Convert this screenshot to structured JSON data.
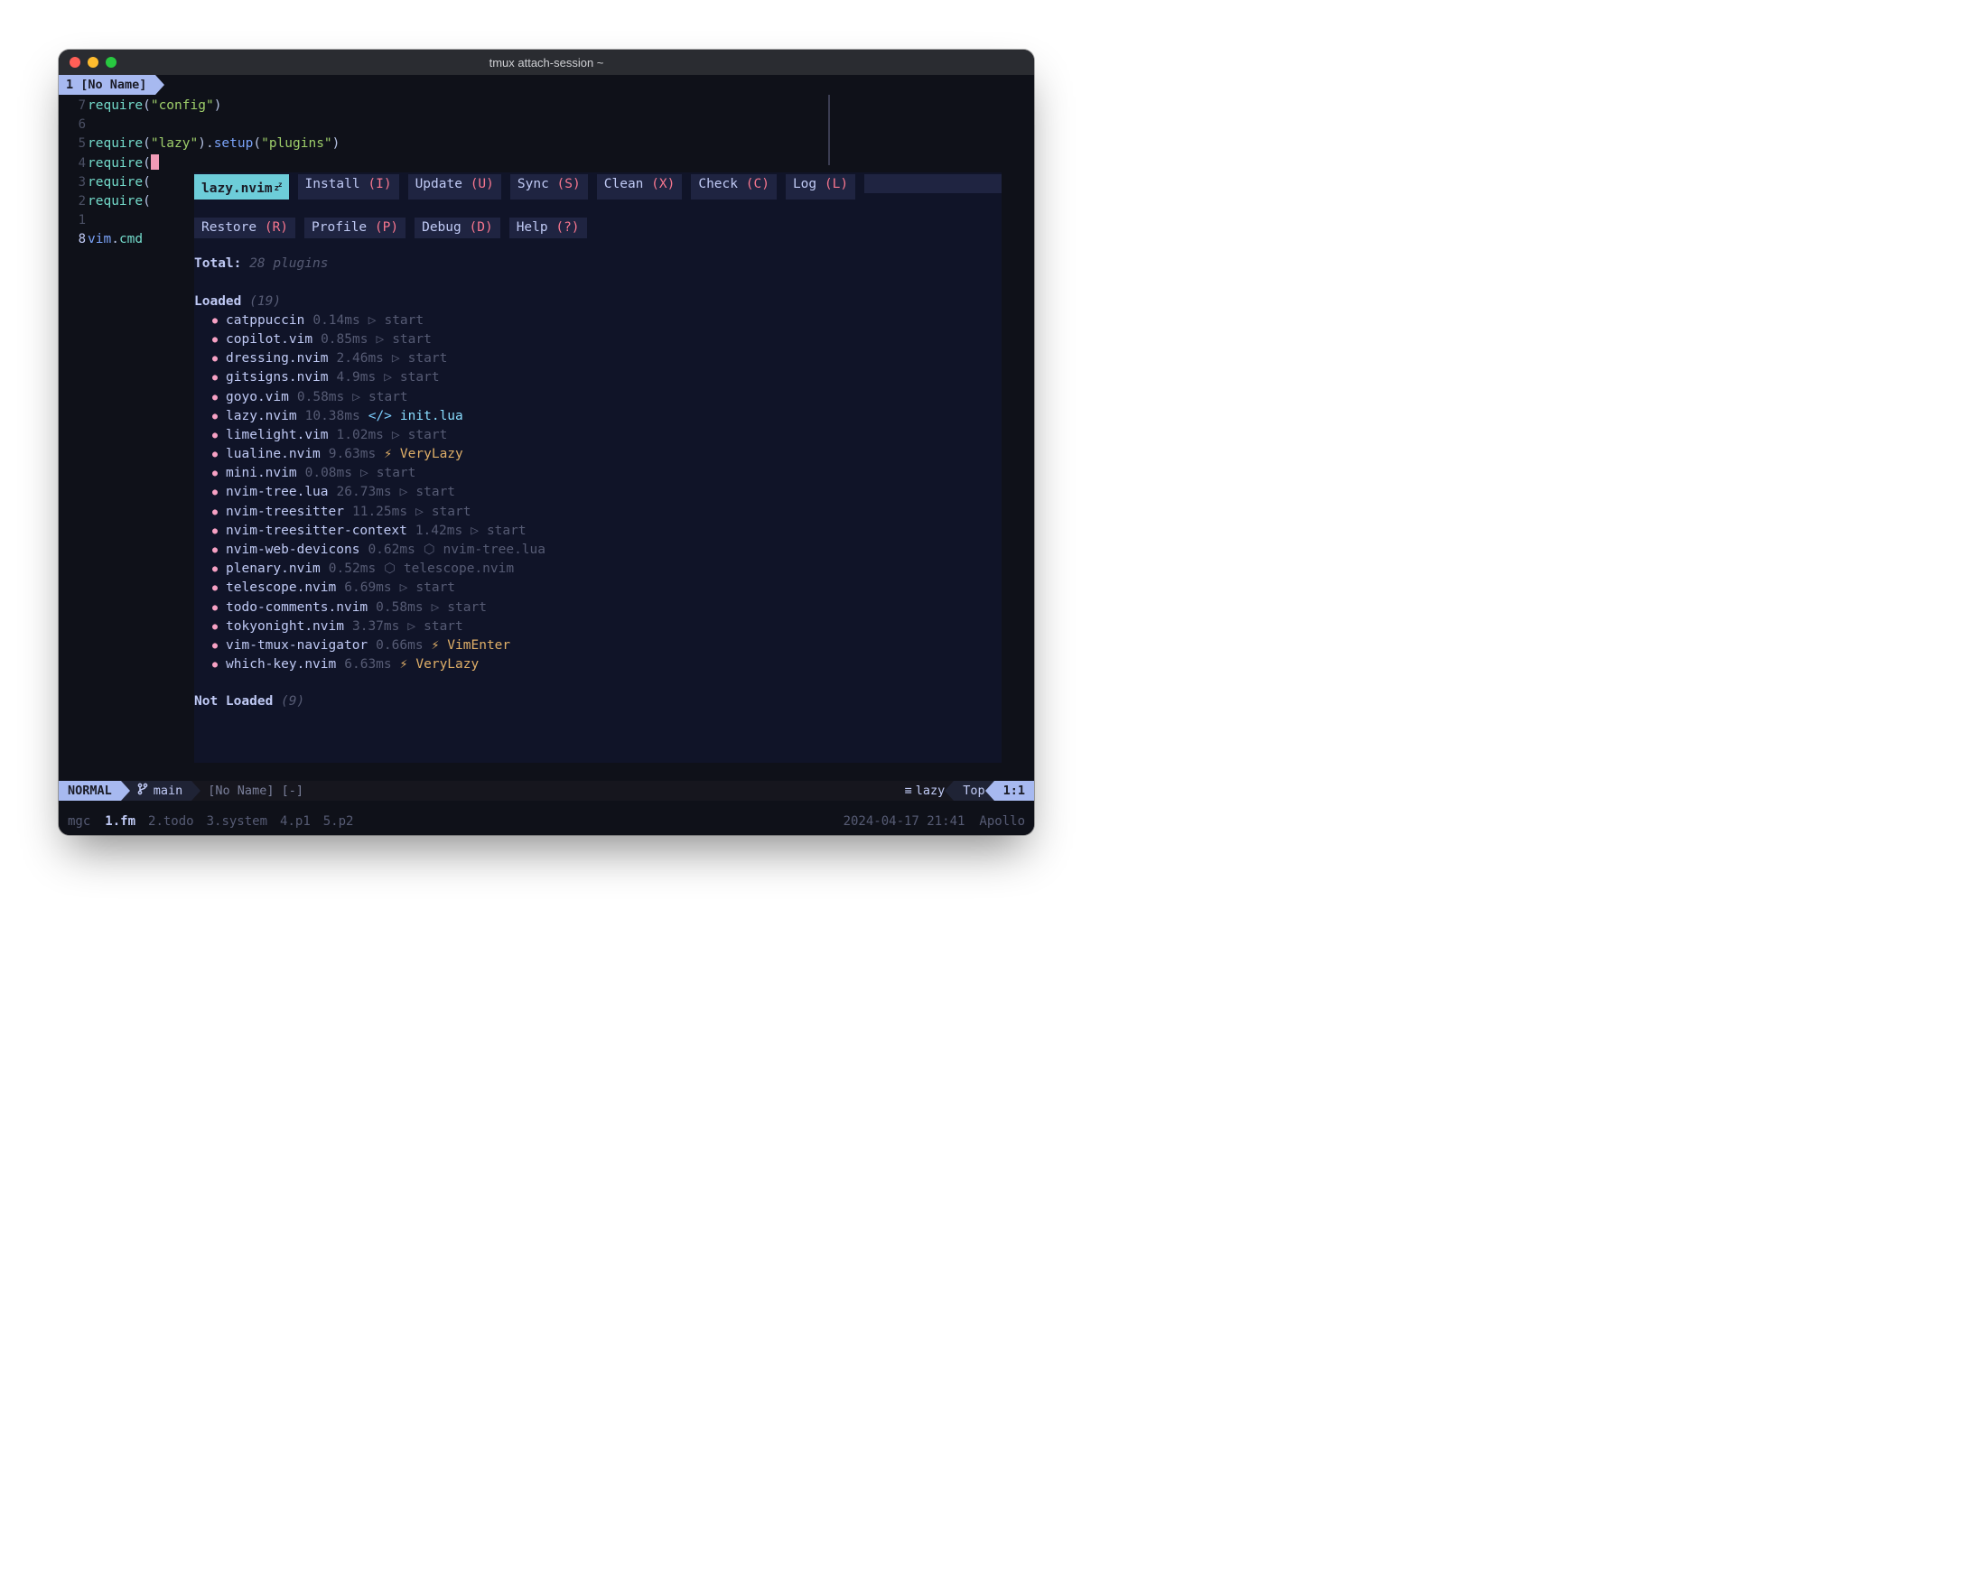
{
  "window": {
    "title": "tmux attach-session ~"
  },
  "tab": {
    "index": "1",
    "name": "[No Name]"
  },
  "gutter": [
    "7",
    "6",
    "5",
    "4",
    "3",
    "2",
    "1",
    "8"
  ],
  "code": {
    "l1": {
      "kw": "require",
      "p1": "(",
      "str": "\"config\"",
      "p2": ")"
    },
    "l3": {
      "kw": "require",
      "p1": "(",
      "str": "\"lazy\"",
      "p2": ").",
      "fn": "setup",
      "p3": "(",
      "str2": "\"plugins\"",
      "p4": ")"
    },
    "l4": {
      "kw": "require",
      "p1": "("
    },
    "l5": {
      "kw": "require",
      "p1": "("
    },
    "l6": {
      "kw": "require",
      "p1": "("
    },
    "l8": {
      "ns": "vim",
      "p1": ".",
      "prop": "cmd"
    }
  },
  "lazy": {
    "name": "lazy.nvim",
    "buttons": [
      {
        "label": "Install",
        "key": "(I)"
      },
      {
        "label": "Update",
        "key": "(U)"
      },
      {
        "label": "Sync",
        "key": "(S)"
      },
      {
        "label": "Clean",
        "key": "(X)"
      },
      {
        "label": "Check",
        "key": "(C)"
      },
      {
        "label": "Log",
        "key": "(L)"
      },
      {
        "label": "Restore",
        "key": "(R)"
      },
      {
        "label": "Profile",
        "key": "(P)"
      },
      {
        "label": "Debug",
        "key": "(D)"
      },
      {
        "label": "Help",
        "key": "(?)"
      }
    ],
    "total_label": "Total:",
    "total_count": "28 plugins",
    "loaded_label": "Loaded",
    "loaded_count": "(19)",
    "notloaded_label": "Not Loaded",
    "notloaded_count": "(9)",
    "plugins": [
      {
        "name": "catppuccin",
        "time": "0.14ms",
        "icon": "tri",
        "ev": "start"
      },
      {
        "name": "copilot.vim",
        "time": "0.85ms",
        "icon": "tri",
        "ev": "start"
      },
      {
        "name": "dressing.nvim",
        "time": "2.46ms",
        "icon": "tri",
        "ev": "start"
      },
      {
        "name": "gitsigns.nvim",
        "time": "4.9ms",
        "icon": "tri",
        "ev": "start"
      },
      {
        "name": "goyo.vim",
        "time": "0.58ms",
        "icon": "tri",
        "ev": "start"
      },
      {
        "name": "lazy.nvim",
        "time": "10.38ms",
        "icon": "lua",
        "ev": "init.lua"
      },
      {
        "name": "limelight.vim",
        "time": "1.02ms",
        "icon": "tri",
        "ev": "start"
      },
      {
        "name": "lualine.nvim",
        "time": "9.63ms",
        "icon": "bolt",
        "ev": "VeryLazy"
      },
      {
        "name": "mini.nvim",
        "time": "0.08ms",
        "icon": "tri",
        "ev": "start"
      },
      {
        "name": "nvim-tree.lua",
        "time": "26.73ms",
        "icon": "tri",
        "ev": "start"
      },
      {
        "name": "nvim-treesitter",
        "time": "11.25ms",
        "icon": "tri",
        "ev": "start"
      },
      {
        "name": "nvim-treesitter-context",
        "time": "1.42ms",
        "icon": "tri",
        "ev": "start"
      },
      {
        "name": "nvim-web-devicons",
        "time": "0.62ms",
        "icon": "pack",
        "ev": "nvim-tree.lua"
      },
      {
        "name": "plenary.nvim",
        "time": "0.52ms",
        "icon": "pack",
        "ev": "telescope.nvim"
      },
      {
        "name": "telescope.nvim",
        "time": "6.69ms",
        "icon": "tri",
        "ev": "start"
      },
      {
        "name": "todo-comments.nvim",
        "time": "0.58ms",
        "icon": "tri",
        "ev": "start"
      },
      {
        "name": "tokyonight.nvim",
        "time": "3.37ms",
        "icon": "tri",
        "ev": "start"
      },
      {
        "name": "vim-tmux-navigator",
        "time": "0.66ms",
        "icon": "bolt",
        "ev": "VimEnter"
      },
      {
        "name": "which-key.nvim",
        "time": "6.63ms",
        "icon": "bolt",
        "ev": "VeryLazy"
      }
    ]
  },
  "status": {
    "mode": "NORMAL",
    "branch": "main",
    "file": "[No Name] [-]",
    "filetype": "lazy",
    "scroll": "Top",
    "pos": "1:1"
  },
  "tmux": {
    "session": "mgc",
    "windows": [
      {
        "i": "1",
        "n": "fm",
        "active": true
      },
      {
        "i": "2",
        "n": "todo"
      },
      {
        "i": "3",
        "n": "system"
      },
      {
        "i": "4",
        "n": "p1"
      },
      {
        "i": "5",
        "n": "p2"
      }
    ],
    "time": "2024-04-17 21:41",
    "host": "Apollo"
  }
}
